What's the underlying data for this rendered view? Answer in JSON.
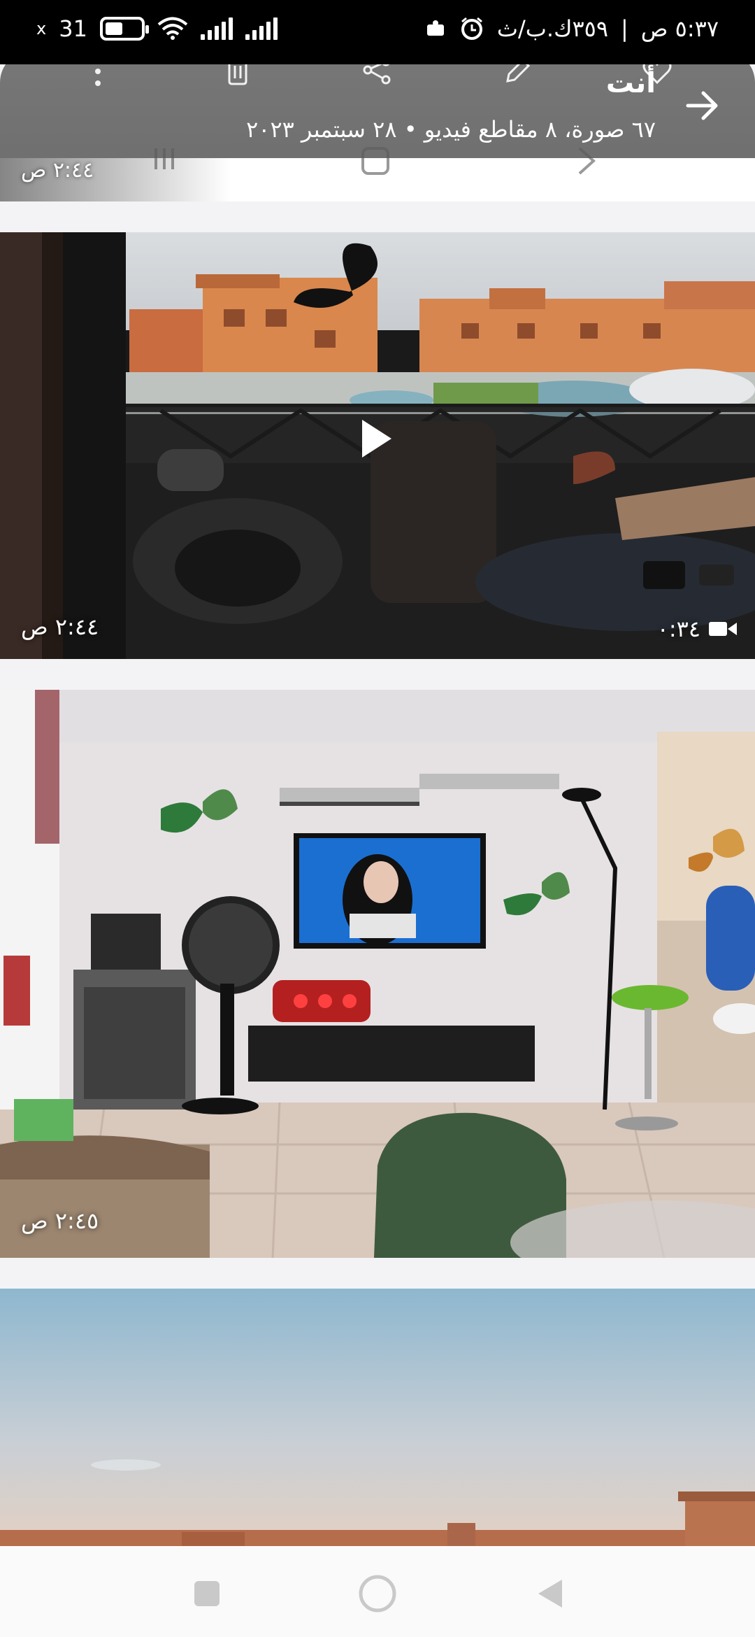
{
  "status_bar": {
    "time": "٥:٣٧ ص",
    "speed": "٣٥٩ك.ب/ث",
    "battery_level": "31"
  },
  "app_bar": {
    "title": "أنت",
    "subtitle": "٦٧ صورة، ٨ مقاطع فيديو • ٢٨ سبتمبر ٢٠٢٣"
  },
  "items": [
    {
      "timestamp": "٢:٤٤ ص"
    },
    {
      "timestamp": "٢:٤٤ ص",
      "duration": "٠:٣٤",
      "is_video": true
    },
    {
      "timestamp": "٢:٤٥ ص"
    },
    {
      "timestamp": ""
    }
  ],
  "icons": {
    "back": "arrow-right-icon",
    "share": "share-icon",
    "edit": "pencil-icon",
    "delete": "trash-icon",
    "more": "more-vertical-icon"
  }
}
